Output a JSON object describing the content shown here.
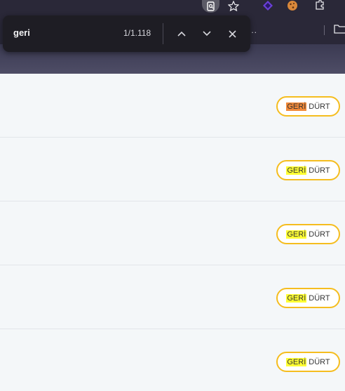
{
  "find_bar": {
    "query": "geri",
    "match_count": "1/1.118",
    "prev_icon": "chevron-up-icon",
    "next_icon": "chevron-down-icon",
    "close_icon": "close-icon"
  },
  "toolbar": {
    "icons": [
      "lens-search-icon",
      "star-icon",
      "extension-icon",
      "cookie-icon",
      "puzzle-icon"
    ],
    "bookmark_overflow": "...",
    "folder_icon": "folder-icon"
  },
  "rows": [
    {
      "highlight": "GERİ",
      "rest": "DÜRT",
      "active": true
    },
    {
      "highlight": "GERİ",
      "rest": "DÜRT",
      "active": false
    },
    {
      "highlight": "GERİ",
      "rest": "DÜRT",
      "active": false
    },
    {
      "highlight": "GERİ",
      "rest": "DÜRT",
      "active": false
    },
    {
      "highlight": "GERİ",
      "rest": "DÜRT",
      "active": false
    }
  ],
  "colors": {
    "pill_border": "#f5bd1f",
    "match_highlight": "#ffff33",
    "active_match_highlight": "#f28a3a",
    "findbar_bg": "#1e1d24"
  }
}
